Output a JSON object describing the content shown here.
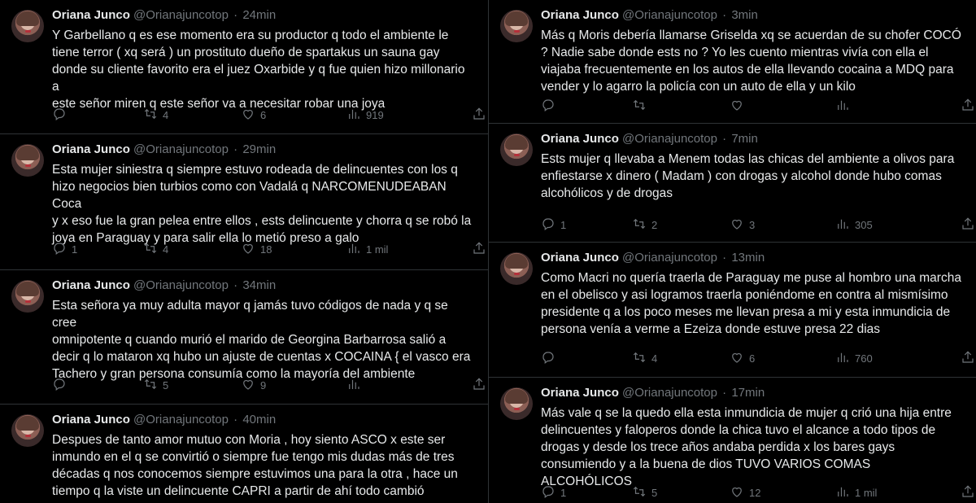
{
  "left": [
    {
      "name": "Oriana Junco",
      "handle": "@Orianajuncotop",
      "time": "24min",
      "text": "Y Garbellano q es ese momento era su productor q todo el ambiente le\ntiene terror ( xq será ) un prostituto dueño de spartakus un sauna gay\ndonde su cliente favorito era el juez Oxarbide y q fue quien hizo millonario a\neste señor miren q este señor va a necesitar robar una joya",
      "replies": "",
      "retweets": "4",
      "likes": "6",
      "views": "919"
    },
    {
      "name": "Oriana Junco",
      "handle": "@Orianajuncotop",
      "time": "29min",
      "text": "Esta mujer siniestra q siempre estuvo rodeada de delincuentes con los q\nhizo negocios bien turbios como con Vadalá q NARCOMENUDEABAN Coca\ny x eso fue la gran pelea entre ellos , ests delincuente y chorra q se robó la\njoya en Paraguay y para salir ella lo metió preso a galo",
      "replies": "1",
      "retweets": "4",
      "likes": "18",
      "views": "1 mil"
    },
    {
      "name": "Oriana Junco",
      "handle": "@Orianajuncotop",
      "time": "34min",
      "text": "Esta señora ya muy adulta mayor q jamás tuvo códigos de nada y q se cree\nomnipotente q cuando murió el marido de Georgina Barbarrosa salió a\ndecir q lo mataron xq hubo un ajuste de cuentas x COCAINA { el vasco era\nTachero y gran persona consumía como la mayoría del ambiente",
      "replies": "",
      "retweets": "5",
      "likes": "9",
      "views": ""
    },
    {
      "name": "Oriana Junco",
      "handle": "@Orianajuncotop",
      "time": "40min",
      "text": "Despues de tanto amor mutuo con Moria , hoy siento ASCO x este ser\ninmundo en el q se convirtió o siempre fue tengo mis dudas más de tres\ndécadas q nos conocemos siempre estuvimos una para la otra , hace un\ntiempo q la viste un delincuente CAPRI a partir de ahí todo cambió",
      "replies": "",
      "retweets": "",
      "likes": "",
      "views": ""
    }
  ],
  "right": [
    {
      "name": "Oriana Junco",
      "handle": "@Orianajuncotop",
      "time": "3min",
      "text": "Más q Moris debería llamarse Griselda xq se acuerdan de su chofer COCÓ\n? Nadie sabe donde ests no ? Yo les cuento mientras vivía con ella el\nviajaba frecuentemente en los autos de ella llevando cocaina a MDQ para\nvender y lo agarro la policía con un auto de ella y un kilo",
      "replies": "",
      "retweets": "",
      "likes": "",
      "views": ""
    },
    {
      "name": "Oriana Junco",
      "handle": "@Orianajuncotop",
      "time": "7min",
      "text": "Ests mujer q llevaba  a Menem todas las chicas del ambiente a olivos para\nenfiestarse x dinero ( Madam ) con drogas y alcohol donde hubo comas\nalcohólicos y de drogas",
      "replies": "1",
      "retweets": "2",
      "likes": "3",
      "views": "305"
    },
    {
      "name": "Oriana Junco",
      "handle": "@Orianajuncotop",
      "time": "13min",
      "text": "Como Macri no quería traerla de Paraguay me puse al hombro una marcha\nen el obelisco y asi logramos traerla poniéndome en contra al mismísimo\npresidente q a los poco meses me llevan presa a mi y esta inmundicia de\npersona venía a verme a Ezeiza donde estuve presa 22 dias",
      "replies": "",
      "retweets": "4",
      "likes": "6",
      "views": "760"
    },
    {
      "name": "Oriana Junco",
      "handle": "@Orianajuncotop",
      "time": "17min",
      "text": "Más vale q se la quedo ella esta inmundicia de mujer q crió una hija entre\ndelincuentes y faloperos  donde la chica tuvo el alcance a todo tipos de\ndrogas y desde los trece años andaba perdida x los bares gays\nconsumiendo y a la buena de dios TUVO VARIOS COMAS ALCOHÓLICOS",
      "replies": "1",
      "retweets": "5",
      "likes": "12",
      "views": "1 mil"
    }
  ],
  "sep": "·",
  "icons": {
    "reply": "reply-icon",
    "retweet": "retweet-icon",
    "like": "heart-icon",
    "views": "views-icon",
    "share": "share-icon"
  }
}
